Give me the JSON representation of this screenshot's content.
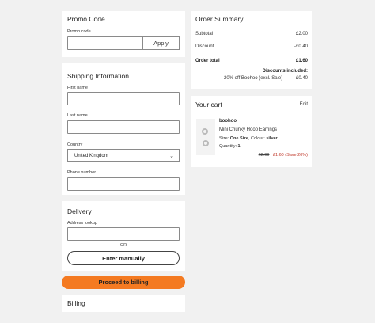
{
  "promo": {
    "title": "Promo Code",
    "field_label": "Promo code",
    "input_value": "",
    "apply_label": "Apply"
  },
  "shipping": {
    "title": "Shipping Information",
    "first_name_label": "First name",
    "last_name_label": "Last name",
    "country_label": "Country",
    "country_value": "United Kingdom",
    "phone_label": "Phone number"
  },
  "delivery": {
    "title": "Delivery",
    "address_label": "Address lookup",
    "or_label": "OR",
    "enter_manually_label": "Enter manually"
  },
  "cta": {
    "proceed_label": "Proceed to billing"
  },
  "billing": {
    "title": "Billing"
  },
  "summary": {
    "title": "Order Summary",
    "subtotal_label": "Subtotal",
    "subtotal_value": "£2.00",
    "discount_label": "Discount",
    "discount_value": "-£0.40",
    "total_label": "Order total",
    "total_value": "£1.60",
    "discounts_included_label": "Discounts included:",
    "discount_detail_label": "20% off Boohoo (excl. Sale)",
    "discount_detail_value": "- £0.40"
  },
  "cart": {
    "title": "Your cart",
    "edit_label": "Edit",
    "item": {
      "brand": "boohoo",
      "name": "Mini Chunky Hoop Earrings",
      "size_prefix": "Size: ",
      "size_value": "One Size",
      "colour_prefix": ", Colour: ",
      "colour_value": "silver",
      "quantity_prefix": "Quantity: ",
      "quantity_value": "1",
      "old_price": "£2.00",
      "new_price": "£1.60",
      "save_text": "(Save 20%)"
    }
  },
  "colors": {
    "accent": "#f47a21",
    "sale": "#c0392b"
  }
}
